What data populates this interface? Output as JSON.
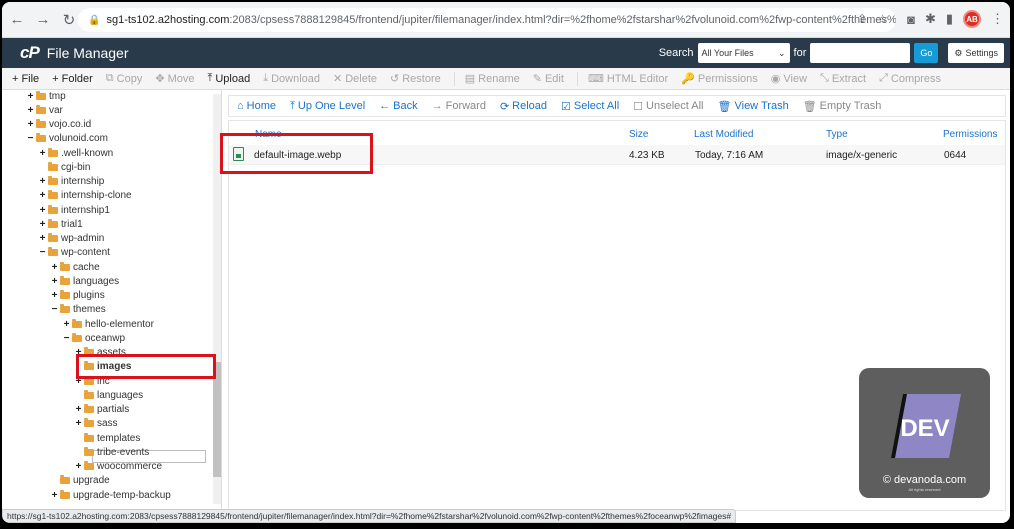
{
  "browser": {
    "url_host": "sg1-ts102.a2hosting.com",
    "url_rest": ":2083/cpsess7888129845/frontend/jupiter/filemanager/index.html?dir=%2fhome%2fstarshar%2fvolunoid.com%2fwp-content%2fthemes%2foceanwp%2fimages",
    "profile_initial": "AB"
  },
  "header": {
    "logo": "cP",
    "title": "File Manager",
    "search_label": "Search",
    "search_scope": "All Your Files",
    "for_label": "for",
    "go_label": "Go",
    "settings_label": "Settings"
  },
  "toolbar": [
    {
      "icon": "+",
      "label": "File",
      "enabled": true
    },
    {
      "icon": "+",
      "label": "Folder",
      "enabled": true
    },
    {
      "icon": "⧉",
      "label": "Copy",
      "enabled": false
    },
    {
      "icon": "✥",
      "label": "Move",
      "enabled": false
    },
    {
      "icon": "⤒",
      "label": "Upload",
      "enabled": true
    },
    {
      "icon": "⤓",
      "label": "Download",
      "enabled": false
    },
    {
      "icon": "✕",
      "label": "Delete",
      "enabled": false
    },
    {
      "icon": "↺",
      "label": "Restore",
      "enabled": false
    },
    {
      "icon": "▤",
      "label": "Rename",
      "enabled": false
    },
    {
      "icon": "✎",
      "label": "Edit",
      "enabled": false
    },
    {
      "icon": "⌨",
      "label": "HTML Editor",
      "enabled": false
    },
    {
      "icon": "🔑",
      "label": "Permissions",
      "enabled": false
    },
    {
      "icon": "◉",
      "label": "View",
      "enabled": false
    },
    {
      "icon": "⤡",
      "label": "Extract",
      "enabled": false
    },
    {
      "icon": "⤢",
      "label": "Compress",
      "enabled": false
    }
  ],
  "tree": [
    {
      "label": "tmp",
      "toggle": "+",
      "depth": 0
    },
    {
      "label": "var",
      "toggle": "+",
      "depth": 0
    },
    {
      "label": "vojo.co.id",
      "toggle": "+",
      "depth": 0
    },
    {
      "label": "volunoid.com",
      "toggle": "−",
      "depth": 0
    },
    {
      "label": ".well-known",
      "toggle": "+",
      "depth": 1
    },
    {
      "label": "cgi-bin",
      "toggle": "",
      "depth": 1
    },
    {
      "label": "internship",
      "toggle": "+",
      "depth": 1
    },
    {
      "label": "internship-clone",
      "toggle": "+",
      "depth": 1
    },
    {
      "label": "internship1",
      "toggle": "+",
      "depth": 1
    },
    {
      "label": "trial1",
      "toggle": "+",
      "depth": 1
    },
    {
      "label": "wp-admin",
      "toggle": "+",
      "depth": 1
    },
    {
      "label": "wp-content",
      "toggle": "−",
      "depth": 1
    },
    {
      "label": "cache",
      "toggle": "+",
      "depth": 2
    },
    {
      "label": "languages",
      "toggle": "+",
      "depth": 2
    },
    {
      "label": "plugins",
      "toggle": "+",
      "depth": 2
    },
    {
      "label": "themes",
      "toggle": "−",
      "depth": 2
    },
    {
      "label": "hello-elementor",
      "toggle": "+",
      "depth": 3
    },
    {
      "label": "oceanwp",
      "toggle": "−",
      "depth": 3
    },
    {
      "label": "assets",
      "toggle": "+",
      "depth": 4
    },
    {
      "label": "images",
      "toggle": "",
      "depth": 4,
      "selected": true
    },
    {
      "label": "inc",
      "toggle": "+",
      "depth": 4
    },
    {
      "label": "languages",
      "toggle": "",
      "depth": 4
    },
    {
      "label": "partials",
      "toggle": "+",
      "depth": 4
    },
    {
      "label": "sass",
      "toggle": "+",
      "depth": 4
    },
    {
      "label": "templates",
      "toggle": "",
      "depth": 4
    },
    {
      "label": "tribe-events",
      "toggle": "",
      "depth": 4
    },
    {
      "label": "woocommerce",
      "toggle": "+",
      "depth": 4
    },
    {
      "label": "upgrade",
      "toggle": "",
      "depth": 2
    },
    {
      "label": "upgrade-temp-backup",
      "toggle": "+",
      "depth": 2
    }
  ],
  "navbar": [
    {
      "icon": "⌂",
      "label": "Home",
      "enabled": true
    },
    {
      "icon": "⤒",
      "label": "Up One Level",
      "enabled": true
    },
    {
      "icon": "←",
      "label": "Back",
      "enabled": true
    },
    {
      "icon": "→",
      "label": "Forward",
      "enabled": false
    },
    {
      "icon": "⟳",
      "label": "Reload",
      "enabled": true
    },
    {
      "icon": "☑",
      "label": "Select All",
      "enabled": true
    },
    {
      "icon": "☐",
      "label": "Unselect All",
      "enabled": false
    },
    {
      "icon": "🗑",
      "label": "View Trash",
      "enabled": true
    },
    {
      "icon": "🗑",
      "label": "Empty Trash",
      "enabled": false
    }
  ],
  "files": {
    "columns": {
      "name": "Name",
      "size": "Size",
      "modified": "Last Modified",
      "type": "Type",
      "permissions": "Permissions"
    },
    "rows": [
      {
        "name": "default-image.webp",
        "size": "4.23 KB",
        "modified": "Today, 7:16 AM",
        "type": "image/x-generic",
        "permissions": "0644"
      }
    ]
  },
  "statusbar": "https://sg1-ts102.a2hosting.com:2083/cpsess7888129845/frontend/jupiter/filemanager/index.html?dir=%2fhome%2fstarshar%2fvolunoid.com%2fwp-content%2fthemes%2foceanwp%2fimages#",
  "watermark": {
    "logo_text": "DEV",
    "site": "© devanoda.com",
    "rights": "All rights reserved"
  },
  "colors": {
    "header": "#293a4a",
    "accent": "#1a73c8",
    "highlight": "#d9121b",
    "folder": "#e8a33d"
  }
}
